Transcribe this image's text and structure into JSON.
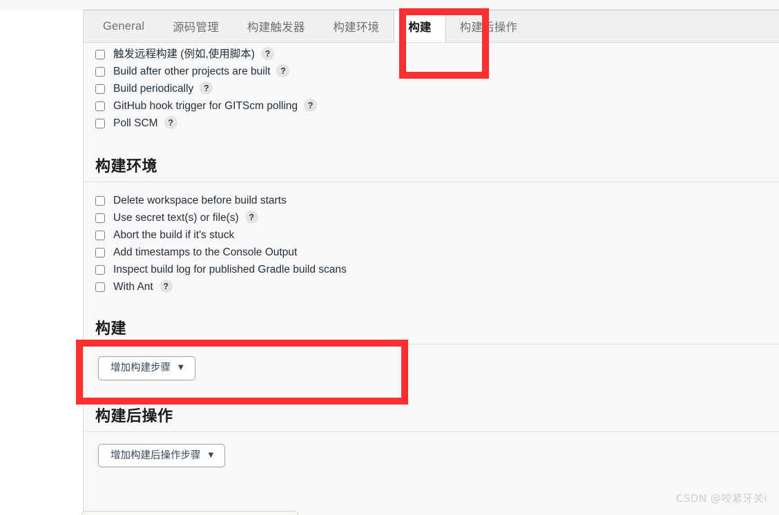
{
  "tabs": [
    {
      "label": "General",
      "active": false
    },
    {
      "label": "源码管理",
      "active": false
    },
    {
      "label": "构建触发器",
      "active": false
    },
    {
      "label": "构建环境",
      "active": false
    },
    {
      "label": "构建",
      "active": true
    },
    {
      "label": "构建后操作",
      "active": false
    }
  ],
  "triggers": {
    "items": [
      {
        "label": "触发远程构建 (例如,使用脚本)",
        "checked": false,
        "help": "?",
        "has_help": true
      },
      {
        "label": "Build after other projects are built",
        "checked": false,
        "help": "?",
        "has_help": true
      },
      {
        "label": "Build periodically",
        "checked": false,
        "help": "?",
        "has_help": true
      },
      {
        "label": "GitHub hook trigger for GITScm polling",
        "checked": false,
        "help": "?",
        "has_help": true
      },
      {
        "label": "Poll SCM",
        "checked": false,
        "help": "?",
        "has_help": true
      }
    ]
  },
  "build_env": {
    "title": "构建环境",
    "items": [
      {
        "label": "Delete workspace before build starts",
        "checked": false,
        "help": "?",
        "has_help": false
      },
      {
        "label": "Use secret text(s) or file(s)",
        "checked": false,
        "help": "?",
        "has_help": true
      },
      {
        "label": "Abort the build if it's stuck",
        "checked": false,
        "help": "?",
        "has_help": false
      },
      {
        "label": "Add timestamps to the Console Output",
        "checked": false,
        "help": "?",
        "has_help": false
      },
      {
        "label": "Inspect build log for published Gradle build scans",
        "checked": false,
        "help": "?",
        "has_help": false
      },
      {
        "label": "With Ant",
        "checked": false,
        "help": "?",
        "has_help": true
      }
    ]
  },
  "build": {
    "title": "构建",
    "add_step_button": "增加构建步骤",
    "caret": "▼"
  },
  "post_build": {
    "title": "构建后操作",
    "add_step_button": "增加构建后操作步骤",
    "caret": "▼"
  },
  "annotations": {
    "color": "#fc3030",
    "boxes": [
      {
        "name": "build-tab-highlight",
        "target": "构建"
      },
      {
        "name": "build-section-highlight",
        "target": "增加构建步骤"
      }
    ]
  },
  "watermark": "CSDN @咬紧牙关i"
}
